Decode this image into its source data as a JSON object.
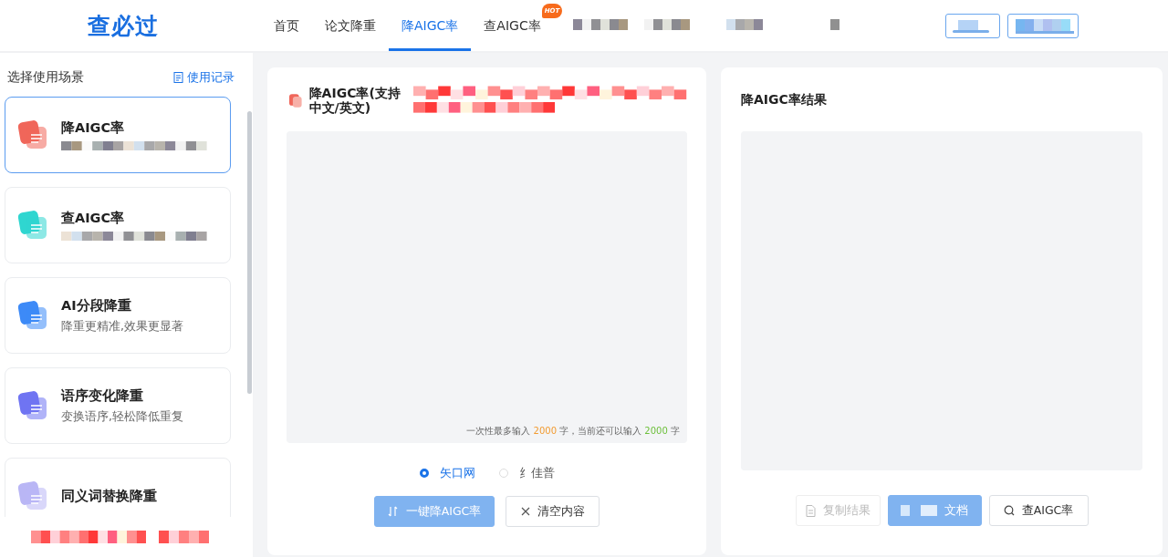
{
  "header": {
    "logo": "查必过",
    "nav": [
      {
        "label": "首页",
        "selected": false
      },
      {
        "label": "论文降重",
        "selected": false
      },
      {
        "label": "降AIGC率",
        "selected": true
      },
      {
        "label": "查AIGC率",
        "selected": false,
        "badge": "HOT"
      }
    ]
  },
  "sidebar": {
    "title": "选择使用场景",
    "history_link": "使用记录",
    "items": [
      {
        "title": "降AIGC率",
        "selected": true,
        "color": "#f0665a"
      },
      {
        "title": "查AIGC率",
        "selected": false,
        "color": "#2fd6d0"
      },
      {
        "title": "AI分段降重",
        "desc": "降重更精准,效果更显著",
        "selected": false,
        "color": "#3d8af7"
      },
      {
        "title": "语序变化降重",
        "desc": "变换语序,轻松降低重复",
        "selected": false,
        "color": "#6f74f2"
      },
      {
        "title": "同义词替换降重",
        "selected": false,
        "color": "#b9b6f5"
      }
    ]
  },
  "input_panel": {
    "title_line1": "降AIGC率(支持",
    "title_line2": "中文/英文)",
    "hint": {
      "before": "一次性最多输入",
      "max": "2000",
      "middle": "字，当前还可以输入",
      "remaining": "2000",
      "after": "字"
    },
    "engines": [
      {
        "label": "矢口网",
        "selected": true
      },
      {
        "label": "纟佳普",
        "selected": false
      }
    ],
    "buttons": [
      {
        "label": "一键降AIGC率",
        "kind": "primary",
        "disabled": true
      },
      {
        "label": "清空内容",
        "kind": "plain",
        "disabled": false
      }
    ]
  },
  "result_panel": {
    "title": "降AIGC率结果",
    "buttons": [
      {
        "label": "复制结果",
        "kind": "copy",
        "disabled": true
      },
      {
        "label": "文档",
        "kind": "download",
        "disabled": true
      },
      {
        "label": "查AIGC率",
        "kind": "check",
        "disabled": false
      }
    ]
  }
}
